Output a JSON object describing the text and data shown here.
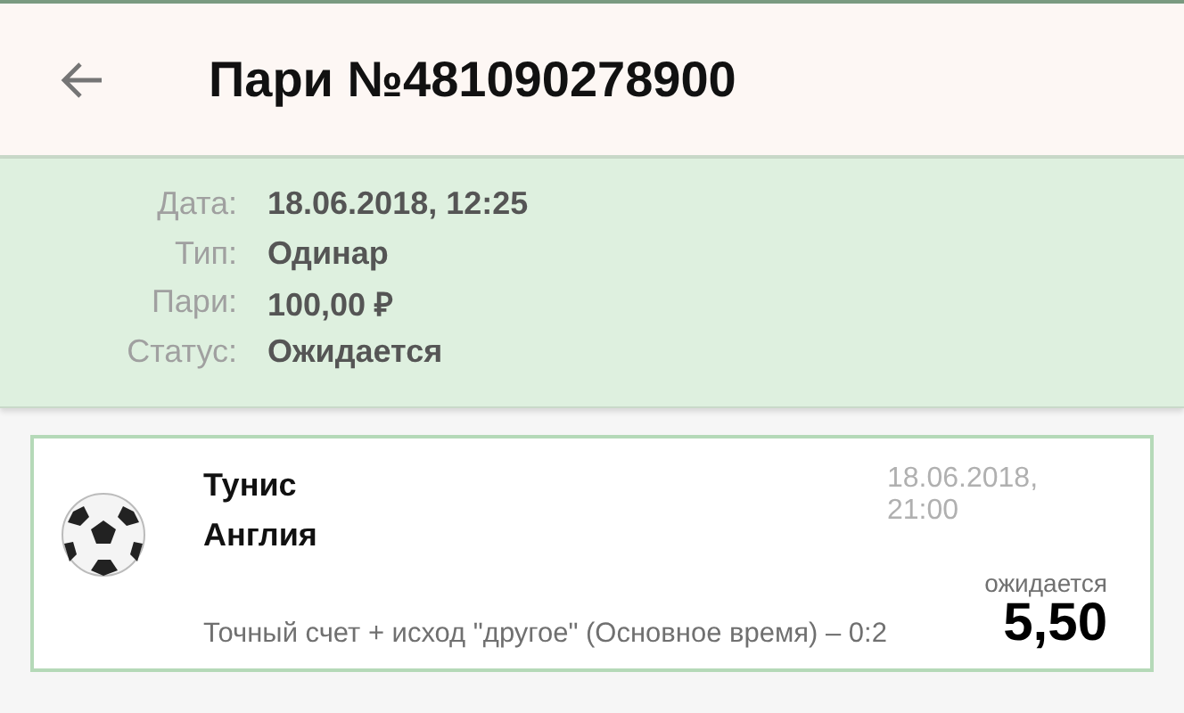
{
  "header": {
    "title": "Пари №481090278900"
  },
  "details": [
    {
      "label": "Дата:",
      "value": "18.06.2018, 12:25"
    },
    {
      "label": "Тип:",
      "value": "Одинар"
    },
    {
      "label": "Пари:",
      "value": "100,00 ₽"
    },
    {
      "label": "Статус:",
      "value": "Ожидается"
    }
  ],
  "event": {
    "team_1": "Тунис",
    "team_2": "Англия",
    "date": "18.06.2018, 21:00",
    "market": "Точный счет + исход \"другое\" (Основное время) – 0:2",
    "status": "ожидается",
    "odds": "5,50"
  }
}
